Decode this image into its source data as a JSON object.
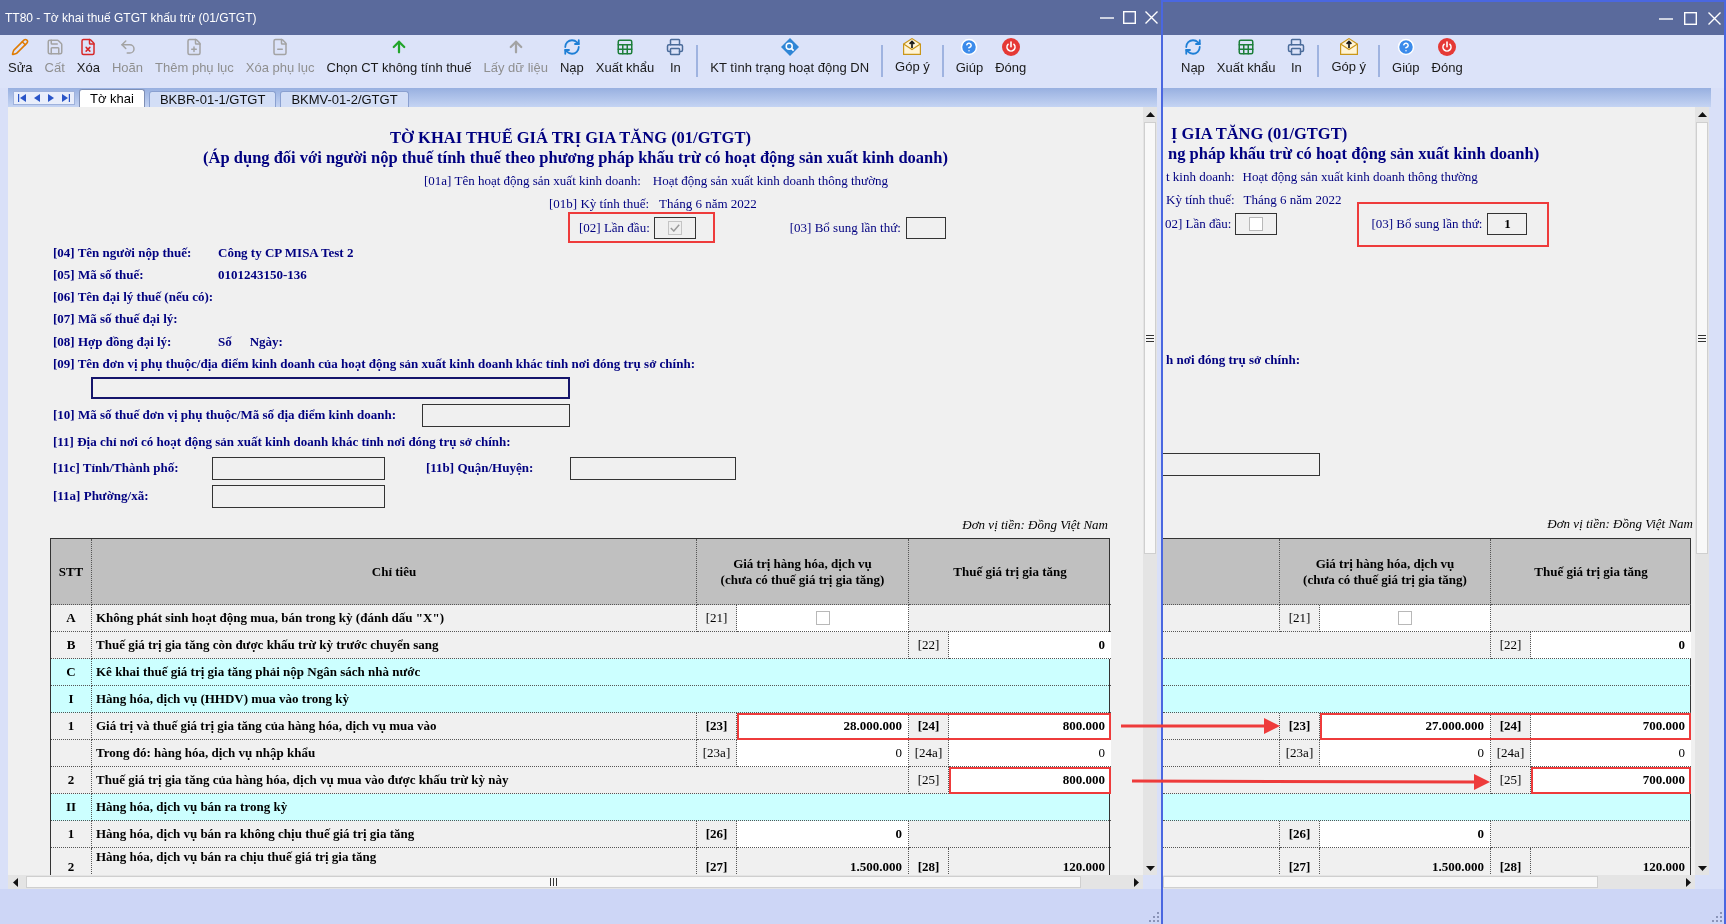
{
  "left_window": {
    "title": "TT80 - Tờ khai thuế GTGT khấu trừ (01/GTGT)",
    "toolbar": [
      {
        "kind": "button",
        "label": "Sửa",
        "disabled": false
      },
      {
        "kind": "button",
        "label": "Cất",
        "disabled": true
      },
      {
        "kind": "button",
        "label": "Xóa",
        "disabled": false
      },
      {
        "kind": "button",
        "label": "Hoãn",
        "disabled": true
      },
      {
        "kind": "button",
        "label": "Thêm phụ lục",
        "disabled": true
      },
      {
        "kind": "button",
        "label": "Xóa phụ lục",
        "disabled": true
      },
      {
        "kind": "button",
        "label": "Chọn CT không tính thuế",
        "disabled": false
      },
      {
        "kind": "button",
        "label": "Lấy dữ liệu",
        "disabled": true
      },
      {
        "kind": "button",
        "label": "Nạp",
        "disabled": false
      },
      {
        "kind": "button",
        "label": "Xuất khẩu",
        "disabled": false
      },
      {
        "kind": "button",
        "label": "In",
        "disabled": false
      },
      {
        "kind": "separator"
      },
      {
        "kind": "button",
        "label": "KT tình trạng hoạt động DN",
        "disabled": false
      },
      {
        "kind": "separator"
      },
      {
        "kind": "button",
        "label": "Góp ý",
        "disabled": false
      },
      {
        "kind": "separator"
      },
      {
        "kind": "button",
        "label": "Giúp",
        "disabled": false
      },
      {
        "kind": "button",
        "label": "Đóng",
        "disabled": false
      }
    ],
    "tabs": [
      {
        "label": "Tờ khai",
        "selected": true
      },
      {
        "label": "BKBR-01-1/GTGT",
        "selected": false
      },
      {
        "label": "BKMV-01-2/GTGT",
        "selected": false
      }
    ],
    "form": {
      "title": "TỜ KHAI THUẾ GIÁ TRỊ GIA TĂNG (01/GTGT)",
      "subtitle": "(Áp dụng đối với người nộp thuế tính thuế theo phương pháp khấu trừ có hoạt động sản xuất kinh doanh)",
      "activity": {
        "label": "[01a] Tên hoạt động sản xuất kinh doanh:",
        "value": "Hoạt động sản xuất kinh doanh thông thường"
      },
      "period": {
        "label": "[01b] Kỳ tính thuế:",
        "value": "Tháng 6 năm 2022"
      },
      "first_time": {
        "label": "[02] Lần đầu:",
        "checked": true,
        "disabled": true,
        "highlighted": true
      },
      "supplement": {
        "label": "[03] Bổ sung lần thứ:"
      },
      "fields": [
        {
          "kind": "text",
          "label": "[04] Tên người nộp thuế:",
          "value": "Công ty CP MISA Test 2"
        },
        {
          "kind": "text",
          "label": "[05] Mã số thuế:",
          "value": "0101243150-136"
        },
        {
          "kind": "text",
          "label": "[06] Tên đại lý thuế (nếu có):"
        },
        {
          "kind": "text",
          "label": "[07] Mã số thuế đại lý:"
        },
        {
          "kind": "contract",
          "label": "[08] Hợp đồng đại lý:",
          "number_label": "Số",
          "date_label": "Ngày:"
        },
        {
          "kind": "wide_input",
          "label": "[09] Tên đơn vị phụ thuộc/địa điểm kinh doanh của hoạt động sản xuất kinh doanh khác tỉnh nơi đóng trụ sở chính:",
          "focused": true
        },
        {
          "kind": "input",
          "label": "[10] Mã số thuế đơn vị phụ thuộc/Mã số địa điểm kinh doanh:",
          "focused": false
        },
        {
          "kind": "heading",
          "label": "[11] Địa chỉ nơi có hoạt động sản xuất kinh doanh khác tỉnh nơi đóng trụ sở chính:"
        },
        {
          "kind": "inputs",
          "items": [
            {
              "label": "[11c] Tỉnh/Thành phố:",
              "focused": false
            },
            {
              "label": "[11b] Quận/Huyện:",
              "focused": false
            }
          ]
        },
        {
          "kind": "inputs",
          "items": [
            {
              "label": "[11a] Phường/xã:",
              "focused": false
            }
          ]
        }
      ],
      "unit": "Đơn vị tiền: Đồng Việt Nam",
      "table": {
        "columns": [
          "STT",
          "Chỉ tiêu",
          "Giá trị hàng hóa, dịch vụ\n(chưa có thuế giá trị gia tăng)",
          "Thuế giá trị gia tăng"
        ],
        "rows": [
          {
            "kind": "item",
            "stt": "A",
            "label": "Không phát sinh hoạt động mua, bán trong kỳ (đánh dấu \"X\")",
            "goods": {
              "kind": "checkbox",
              "code": "[21]",
              "checked": false,
              "code_bold": false,
              "editable": true
            }
          },
          {
            "kind": "item",
            "stt": "B",
            "label": "Thuế giá trị gia tăng còn được khấu trừ kỳ trước chuyển sang",
            "tax": {
              "kind": "number",
              "code": "[22]",
              "value": "0",
              "code_bold": false,
              "value_bold": true,
              "editable": true
            }
          },
          {
            "kind": "section",
            "stt": "C",
            "label": "Kê khai thuế giá trị gia tăng phải nộp Ngân sách nhà nước"
          },
          {
            "kind": "section",
            "stt": "I",
            "label": "Hàng hóa, dịch vụ (HHDV) mua vào trong kỳ"
          },
          {
            "kind": "item",
            "stt": "1",
            "label": "Giá trị và thuế giá trị gia tăng của hàng hóa, dịch vụ mua vào",
            "goods": {
              "kind": "number",
              "code": "[23]",
              "value": "28.000.000",
              "code_bold": true,
              "value_bold": true,
              "editable": true,
              "highlighted": true
            },
            "tax": {
              "kind": "number",
              "code": "[24]",
              "value": "800.000",
              "code_bold": true,
              "value_bold": true,
              "editable": true,
              "highlighted": true
            }
          },
          {
            "kind": "item",
            "label": "Trong đó: hàng hóa, dịch vụ nhập khẩu",
            "goods": {
              "kind": "number",
              "code": "[23a]",
              "value": "0",
              "code_bold": false,
              "value_bold": false,
              "editable": true
            },
            "tax": {
              "kind": "number",
              "code": "[24a]",
              "value": "0",
              "code_bold": false,
              "value_bold": false,
              "editable": true
            }
          },
          {
            "kind": "item",
            "stt": "2",
            "label": "Thuế giá trị gia tăng của hàng hóa, dịch vụ mua vào được khấu trừ kỳ này",
            "tax": {
              "kind": "number",
              "code": "[25]",
              "value": "800.000",
              "code_bold": false,
              "value_bold": true,
              "editable": true,
              "highlighted": true
            }
          },
          {
            "kind": "section",
            "stt": "II",
            "label": "Hàng hóa, dịch vụ bán ra trong kỳ"
          },
          {
            "kind": "item",
            "stt": "1",
            "label": "Hàng hóa, dịch vụ bán ra không chịu thuế giá trị gia tăng",
            "goods": {
              "kind": "number",
              "code": "[26]",
              "value": "0",
              "code_bold": true,
              "value_bold": true,
              "editable": true
            }
          },
          {
            "kind": "item",
            "stt": "2",
            "label": "Hàng hóa, dịch vụ bán ra chịu thuế giá trị gia tăng",
            "goods": {
              "kind": "number",
              "code": "[27]",
              "value": "1.500.000",
              "code_bold": true,
              "value_bold": true,
              "editable": false
            },
            "tax": {
              "kind": "number",
              "code": "[28]",
              "value": "120.000",
              "code_bold": true,
              "value_bold": true,
              "editable": false
            }
          }
        ]
      }
    }
  },
  "right_window": {
    "toolbar": [
      {
        "kind": "button",
        "label": "Nạp",
        "disabled": false
      },
      {
        "kind": "button",
        "label": "Xuất khẩu",
        "disabled": false
      },
      {
        "kind": "button",
        "label": "In",
        "disabled": false
      },
      {
        "kind": "separator"
      },
      {
        "kind": "button",
        "label": "Góp ý",
        "disabled": false
      },
      {
        "kind": "separator"
      },
      {
        "kind": "button",
        "label": "Giúp",
        "disabled": false
      },
      {
        "kind": "button",
        "label": "Đóng",
        "disabled": false
      }
    ],
    "form": {
      "title": "Ị GIA TĂNG (01/GTGT)",
      "subtitle": "ng pháp khấu trừ có hoạt động sản xuất kinh doanh)",
      "activity": {
        "label": "t kinh doanh:",
        "value": "Hoạt động sản xuất kinh doanh thông thường"
      },
      "period": {
        "label": "Kỳ tính thuế:",
        "value": "Tháng 6 năm 2022"
      },
      "first_time": {
        "label": "02] Lần đầu:",
        "checked": false,
        "disabled": false
      },
      "supplement": {
        "label": "[03] Bổ sung lần thứ:",
        "value": "1",
        "highlighted": true
      },
      "heading": "h nơi đóng trụ sở chính:",
      "unit": "Đơn vị tiền: Đồng Việt Nam",
      "table": {
        "columns": [
          "Giá trị hàng hóa, dịch vụ\n(chưa có thuế giá trị gia tăng)",
          "Thuế giá trị gia tăng"
        ],
        "rows": [
          {
            "kind": "item",
            "goods": {
              "kind": "checkbox",
              "code": "[21]",
              "checked": false,
              "code_bold": false,
              "editable": true
            }
          },
          {
            "kind": "item",
            "tax": {
              "kind": "number",
              "code": "[22]",
              "value": "0",
              "code_bold": false,
              "value_bold": true,
              "editable": true
            }
          },
          {
            "kind": "section"
          },
          {
            "kind": "section"
          },
          {
            "kind": "item",
            "goods": {
              "kind": "number",
              "code": "[23]",
              "value": "27.000.000",
              "code_bold": true,
              "value_bold": true,
              "editable": true,
              "highlighted": true
            },
            "tax": {
              "kind": "number",
              "code": "[24]",
              "value": "700.000",
              "code_bold": true,
              "value_bold": true,
              "editable": true,
              "highlighted": true
            }
          },
          {
            "kind": "item",
            "goods": {
              "kind": "number",
              "code": "[23a]",
              "value": "0",
              "code_bold": false,
              "value_bold": false,
              "editable": true
            },
            "tax": {
              "kind": "number",
              "code": "[24a]",
              "value": "0",
              "code_bold": false,
              "value_bold": false,
              "editable": true
            }
          },
          {
            "kind": "item",
            "tax": {
              "kind": "number",
              "code": "[25]",
              "value": "700.000",
              "code_bold": false,
              "value_bold": true,
              "editable": true,
              "highlighted": true
            }
          },
          {
            "kind": "section"
          },
          {
            "kind": "item",
            "goods": {
              "kind": "number",
              "code": "[26]",
              "value": "0",
              "code_bold": true,
              "value_bold": true,
              "editable": true
            }
          },
          {
            "kind": "item",
            "goods": {
              "kind": "number",
              "code": "[27]",
              "value": "1.500.000",
              "code_bold": true,
              "value_bold": true,
              "editable": false
            },
            "tax": {
              "kind": "number",
              "code": "[28]",
              "value": "120.000",
              "code_bold": true,
              "value_bold": true,
              "editable": false
            }
          }
        ]
      }
    }
  }
}
